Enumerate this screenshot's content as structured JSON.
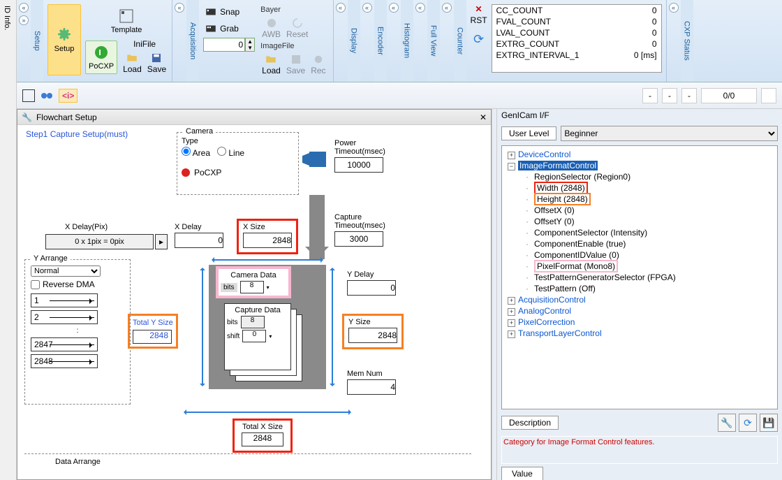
{
  "leftTab": "ID Info.",
  "ribbon": {
    "setupTab": "Setup",
    "setupBtn": "Setup",
    "templateBtn": "Template",
    "pocxpBtn": "PoCXP",
    "inifileLbl": "IniFile",
    "loadBtn": "Load",
    "saveBtn": "Save",
    "acqTab": "Acquisition",
    "snapBtn": "Snap",
    "grabBtn": "Grab",
    "bayerLbl": "Bayer",
    "awbBtn": "AWB",
    "resetBtn": "Reset",
    "imgFileLbl": "ImageFile",
    "imgLoad": "Load",
    "imgSave": "Save",
    "imgRec": "Rec",
    "numVal": "0",
    "displayTab": "Display",
    "encoderTab": "Encoder",
    "histTab": "Histogram",
    "fullviewTab": "Full View",
    "counterTab": "Counter",
    "rstBtn": "RST",
    "cxpTab": "CXP Status",
    "counters": [
      {
        "n": "CC_COUNT",
        "v": "0"
      },
      {
        "n": "FVAL_COUNT",
        "v": "0"
      },
      {
        "n": "LVAL_COUNT",
        "v": "0"
      },
      {
        "n": "EXTRG_COUNT",
        "v": "0"
      },
      {
        "n": "EXTRG_INTERVAL_1",
        "v": "0 [ms]"
      }
    ]
  },
  "toolbar": {
    "ratio": "0/0"
  },
  "flowchart": {
    "title": "Flowchart Setup",
    "step": "Step1   Capture Setup(must)",
    "camera": {
      "group": "Camera",
      "type": "Type",
      "area": "Area",
      "line": "Line",
      "pocxp": "PoCXP"
    },
    "power": {
      "lbl": "Power\nTimeout(msec)",
      "val": "10000"
    },
    "xdelayPix": {
      "lbl": "X Delay(Pix)",
      "val": "0 x 1pix = 0pix"
    },
    "xdelay": {
      "lbl": "X Delay",
      "val": "0"
    },
    "xsize": {
      "lbl": "X Size",
      "val": "2848"
    },
    "capTimeout": {
      "lbl": "Capture\nTimeout(msec)",
      "val": "3000"
    },
    "yarr": {
      "group": "Y Arrange",
      "sel": "Normal",
      "rev": "Reverse DMA",
      "rows": [
        "1",
        "2",
        ":",
        "2847",
        "2848"
      ]
    },
    "totalY": {
      "lbl": "Total Y Size",
      "val": "2848"
    },
    "camData": {
      "lbl": "Camera Data",
      "bits": "bits",
      "bitsVal": "8"
    },
    "capData": {
      "lbl": "Capture Data",
      "bits": "bits",
      "bitsVal": "8",
      "shift": "shift",
      "shiftVal": "0"
    },
    "ydelay": {
      "lbl": "Y Delay",
      "val": "0"
    },
    "ysize": {
      "lbl": "Y Size",
      "val": "2848"
    },
    "memnum": {
      "lbl": "Mem Num",
      "val": "4"
    },
    "totalX": {
      "lbl": "Total X Size",
      "val": "2848"
    },
    "dataArr": "Data Arrange"
  },
  "genicam": {
    "head": "GenICam I/F",
    "userLevel": "User Level",
    "level": "Beginner",
    "tree": {
      "deviceControl": "DeviceControl",
      "imgFmt": "ImageFormatControl",
      "nodes": [
        "RegionSelector (Region0)",
        "Width (2848)",
        "Height (2848)",
        "OffsetX (0)",
        "OffsetY (0)",
        "ComponentSelector (Intensity)",
        "ComponentEnable (true)",
        "ComponentIDValue (0)",
        "PixelFormat (Mono8)",
        "TestPatternGeneratorSelector (FPGA)",
        "TestPattern (Off)"
      ],
      "acq": "AcquisitionControl",
      "analog": "AnalogControl",
      "pixCorr": "PixelCorrection",
      "transport": "TransportLayerControl"
    },
    "descBtn": "Description",
    "descTxt": "Category for Image Format Control features.",
    "valBtn": "Value"
  }
}
